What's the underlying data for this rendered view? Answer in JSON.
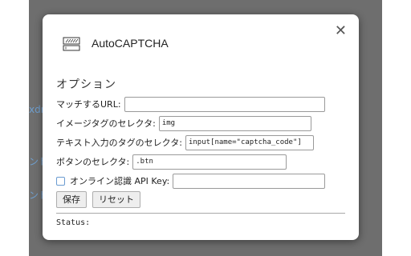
{
  "background": {
    "fragments": [
      "xdn",
      "ンド",
      "ンド"
    ]
  },
  "dialog": {
    "close_glyph": "✕",
    "app_title": "AutoCAPTCHA",
    "section_title": "オプション",
    "fields": {
      "match_url": {
        "label": "マッチするURL:",
        "value": ""
      },
      "image_tag": {
        "label": "イメージタグのセレクタ:",
        "value": "img"
      },
      "text_input": {
        "label": "テキスト入力のタグのセレクタ:",
        "value": "input[name=\"captcha_code\"]"
      },
      "button": {
        "label": "ボタンのセレクタ:",
        "value": ".btn"
      },
      "api_key": {
        "label": "オンライン認識 API Key:",
        "value": ""
      }
    },
    "online_recognition_checked": false,
    "buttons": {
      "save": "保存",
      "reset": "リセット"
    },
    "status_label": "Status:"
  }
}
